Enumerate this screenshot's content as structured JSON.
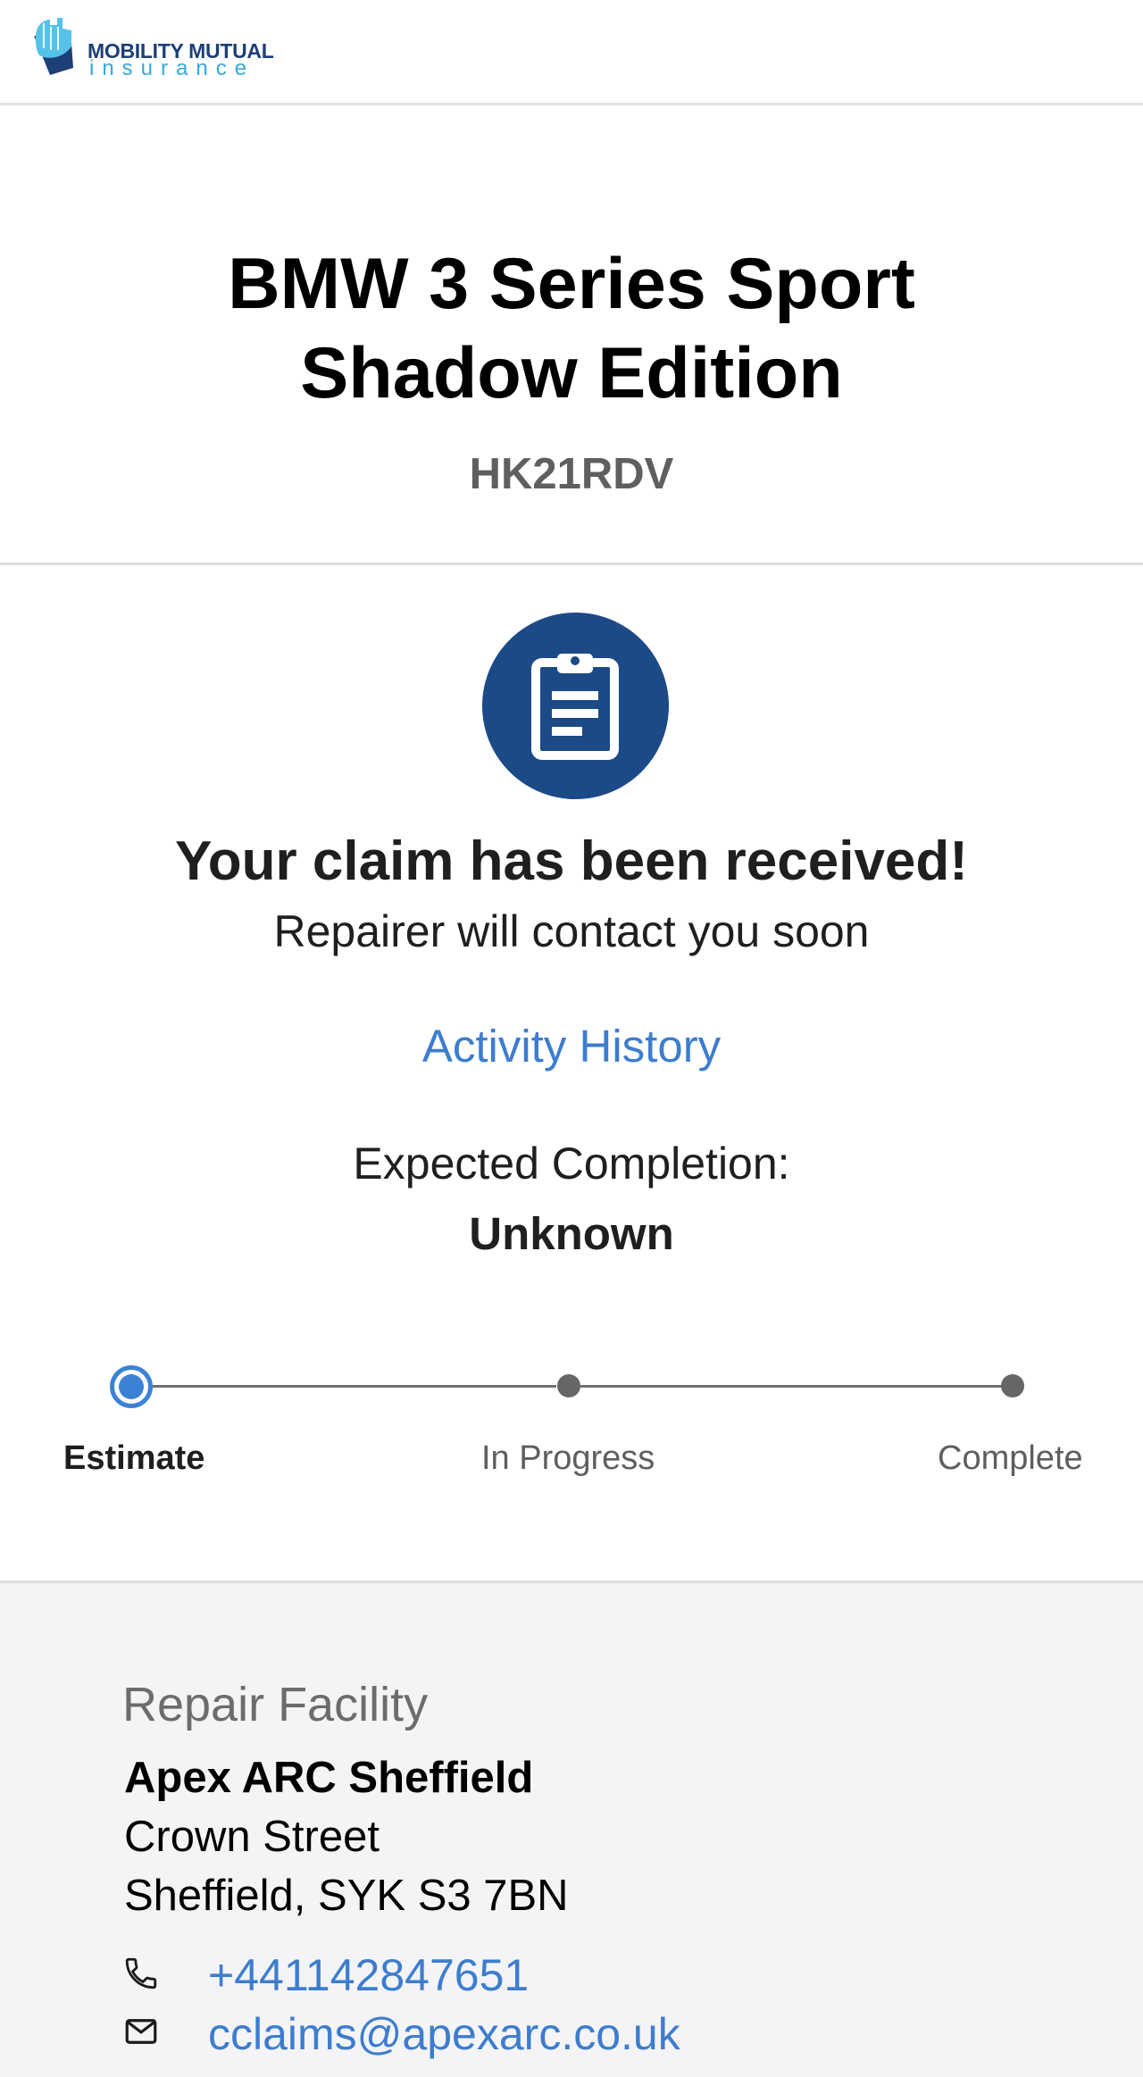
{
  "header": {
    "logo_line1": "MOBILITY MUTUAL",
    "logo_line2": "insurance",
    "colors": {
      "brand_navy": "#1d3f77",
      "brand_sky": "#39a7dc"
    }
  },
  "vehicle": {
    "title": "BMW 3 Series Sport\nShadow Edition",
    "registration": "HK21RDV"
  },
  "status": {
    "icon": "clipboard-icon",
    "title": "Your claim has been received!",
    "subtitle": "Repairer will contact you soon",
    "activity_link": "Activity History",
    "expected_label": "Expected Completion:",
    "expected_value": "Unknown",
    "steps": [
      {
        "label": "Estimate",
        "state": "current"
      },
      {
        "label": "In Progress",
        "state": "pending"
      },
      {
        "label": "Complete",
        "state": "pending"
      }
    ],
    "colors": {
      "icon_circle": "#1c4a87",
      "active_step": "#3b82d6",
      "link": "#3d7dce"
    }
  },
  "facility": {
    "heading": "Repair Facility",
    "name": "Apex ARC Sheffield",
    "address_line1": "Crown Street",
    "address_line2": "Sheffield, SYK S3 7BN",
    "phone": "+441142847651",
    "email": "cclaims@apexarc.co.uk"
  }
}
